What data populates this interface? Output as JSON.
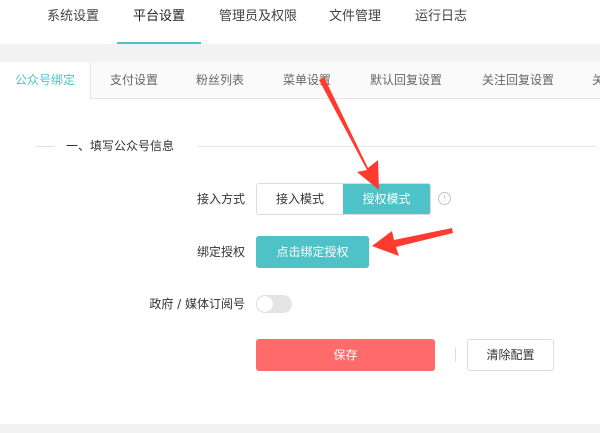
{
  "top_nav": {
    "tabs": [
      {
        "label": "系统设置",
        "active": false
      },
      {
        "label": "平台设置",
        "active": true
      },
      {
        "label": "管理员及权限",
        "active": false
      },
      {
        "label": "文件管理",
        "active": false
      },
      {
        "label": "运行日志",
        "active": false
      }
    ]
  },
  "sub_tabs": [
    {
      "label": "公众号绑定",
      "active": true
    },
    {
      "label": "支付设置",
      "active": false
    },
    {
      "label": "粉丝列表",
      "active": false
    },
    {
      "label": "菜单设置",
      "active": false
    },
    {
      "label": "默认回复设置",
      "active": false
    },
    {
      "label": "关注回复设置",
      "active": false
    },
    {
      "label": "关",
      "active": false
    }
  ],
  "section": {
    "title": "一、填写公众号信息"
  },
  "form": {
    "access_mode": {
      "label": "接入方式",
      "options": [
        "接入模式",
        "授权模式"
      ],
      "selected": "授权模式",
      "info_icon": "info-icon"
    },
    "bind_auth": {
      "label": "绑定授权",
      "button_label": "点击绑定授权"
    },
    "gov_media": {
      "label": "政府 / 媒体订阅号",
      "enabled": false
    },
    "actions": {
      "save_label": "保存",
      "clear_label": "清除配置"
    }
  },
  "colors": {
    "accent": "#4ec2c6",
    "save": "#ff6a6a",
    "annotation_arrow": "#ff3b30"
  }
}
